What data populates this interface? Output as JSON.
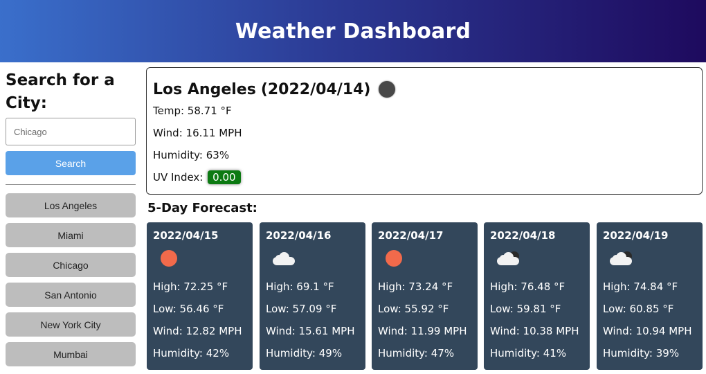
{
  "header": {
    "title": "Weather Dashboard"
  },
  "sidebar": {
    "heading": "Search for a City:",
    "search_placeholder": "Chicago",
    "search_value": "",
    "search_button": "Search",
    "history": [
      "Los Angeles",
      "Miami",
      "Chicago",
      "San Antonio",
      "New York City",
      "Mumbai"
    ]
  },
  "current": {
    "city": "Los Angeles",
    "date": "(2022/04/14)",
    "icon": "moon-icon",
    "temp": "Temp: 58.71 °F",
    "wind": "Wind: 16.11 MPH",
    "humidity": "Humidity: 63%",
    "uv_label": "UV Index:",
    "uv_value": "0.00",
    "uv_color": "#0c7a12"
  },
  "forecast": {
    "title": "5-Day Forecast:",
    "days": [
      {
        "date": "2022/04/15",
        "icon": "sun-icon",
        "high": "High: 72.25 °F",
        "low": "Low: 56.46 °F",
        "wind": "Wind: 12.82 MPH",
        "humidity": "Humidity: 42%"
      },
      {
        "date": "2022/04/16",
        "icon": "cloud-icon",
        "high": "High: 69.1 °F",
        "low": "Low: 57.09 °F",
        "wind": "Wind: 15.61 MPH",
        "humidity": "Humidity: 49%"
      },
      {
        "date": "2022/04/17",
        "icon": "sun-icon",
        "high": "High: 73.24 °F",
        "low": "Low: 55.92 °F",
        "wind": "Wind: 11.99 MPH",
        "humidity": "Humidity: 47%"
      },
      {
        "date": "2022/04/18",
        "icon": "cloud-night-icon",
        "high": "High: 76.48 °F",
        "low": "Low: 59.81 °F",
        "wind": "Wind: 10.38 MPH",
        "humidity": "Humidity: 41%"
      },
      {
        "date": "2022/04/19",
        "icon": "cloud-night-icon",
        "high": "High: 74.84 °F",
        "low": "Low: 60.85 °F",
        "wind": "Wind: 10.94 MPH",
        "humidity": "Humidity: 39%"
      }
    ]
  },
  "colors": {
    "header_gradient_start": "#3a6fcb",
    "header_gradient_end": "#1e0a5e",
    "search_button": "#5aa1e8",
    "history_button": "#bdbdbd",
    "card_background": "#33475b",
    "sun": "#f26a4b"
  }
}
